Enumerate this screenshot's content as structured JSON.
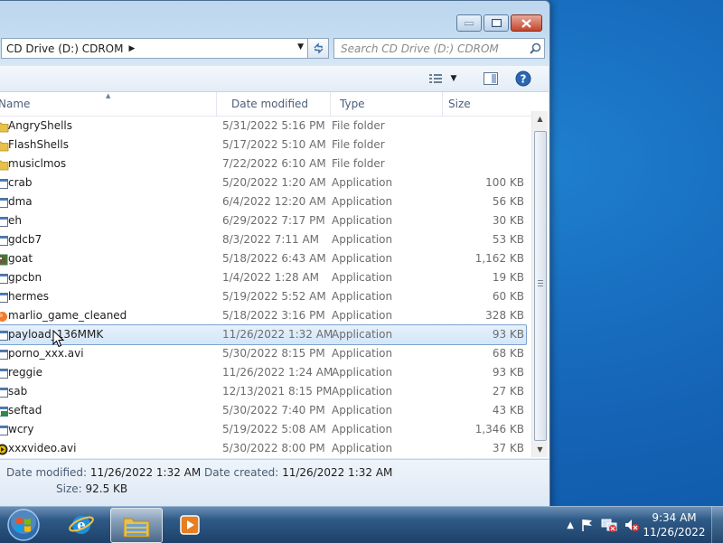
{
  "window": {
    "address_path": "CD Drive (D:) CDROM",
    "search_placeholder": "Search CD Drive (D:) CDROM"
  },
  "columns": {
    "name": "Name",
    "date_modified": "Date modified",
    "type": "Type",
    "size": "Size"
  },
  "files": [
    {
      "name": "AngryShells",
      "date": "5/31/2022 5:16 PM",
      "type": "File folder",
      "size": "",
      "icon": "folder-icon"
    },
    {
      "name": "FlashShells",
      "date": "5/17/2022 5:10 AM",
      "type": "File folder",
      "size": "",
      "icon": "folder-icon"
    },
    {
      "name": "musiclmos",
      "date": "7/22/2022 6:10 AM",
      "type": "File folder",
      "size": "",
      "icon": "folder-icon"
    },
    {
      "name": "crab",
      "date": "5/20/2022 1:20 AM",
      "type": "Application",
      "size": "100 KB",
      "icon": "application-icon"
    },
    {
      "name": "dma",
      "date": "6/4/2022 12:20 AM",
      "type": "Application",
      "size": "56 KB",
      "icon": "application-icon"
    },
    {
      "name": "eh",
      "date": "6/29/2022 7:17 PM",
      "type": "Application",
      "size": "30 KB",
      "icon": "application-icon"
    },
    {
      "name": "gdcb7",
      "date": "8/3/2022 7:11 AM",
      "type": "Application",
      "size": "53 KB",
      "icon": "application-icon"
    },
    {
      "name": "goat",
      "date": "5/18/2022 6:43 AM",
      "type": "Application",
      "size": "1,162 KB",
      "icon": "goat-app-icon"
    },
    {
      "name": "gpcbn",
      "date": "1/4/2022 1:28 AM",
      "type": "Application",
      "size": "19 KB",
      "icon": "application-icon"
    },
    {
      "name": "hermes",
      "date": "5/19/2022 5:52 AM",
      "type": "Application",
      "size": "60 KB",
      "icon": "application-icon"
    },
    {
      "name": "marlio_game_cleaned",
      "date": "5/18/2022 3:16 PM",
      "type": "Application",
      "size": "328 KB",
      "icon": "game-app-icon"
    },
    {
      "name": "payload_136MMK",
      "date": "11/26/2022 1:32 AM",
      "type": "Application",
      "size": "93 KB",
      "icon": "application-icon",
      "selected": true
    },
    {
      "name": "porno_xxx.avi",
      "date": "5/30/2022 8:15 PM",
      "type": "Application",
      "size": "68 KB",
      "icon": "application-icon"
    },
    {
      "name": "reggie",
      "date": "11/26/2022 1:24 AM",
      "type": "Application",
      "size": "93 KB",
      "icon": "application-icon"
    },
    {
      "name": "sab",
      "date": "12/13/2021 8:15 PM",
      "type": "Application",
      "size": "27 KB",
      "icon": "application-icon"
    },
    {
      "name": "seftad",
      "date": "5/30/2022 7:40 PM",
      "type": "Application",
      "size": "43 KB",
      "icon": "installer-app-icon"
    },
    {
      "name": "wcry",
      "date": "5/19/2022 5:08 AM",
      "type": "Application",
      "size": "1,346 KB",
      "icon": "application-icon"
    },
    {
      "name": "xxxvideo.avi",
      "date": "5/30/2022 8:00 PM",
      "type": "Application",
      "size": "37 KB",
      "icon": "media-app-icon"
    }
  ],
  "details": {
    "date_modified_label": "Date modified:",
    "date_modified_value": "11/26/2022 1:32 AM",
    "date_created_label": "Date created:",
    "date_created_value": "11/26/2022 1:32 AM",
    "size_label": "Size:",
    "size_value": "92.5 KB"
  },
  "taskbar": {
    "apps": [
      "internet-explorer-icon",
      "windows-explorer-icon",
      "media-player-icon"
    ],
    "clock_time": "9:34 AM",
    "clock_date": "11/26/2022"
  },
  "colors": {
    "selection_border": "#7da2ce",
    "desktop": "#1565b8",
    "folder": "#e8c04a"
  }
}
